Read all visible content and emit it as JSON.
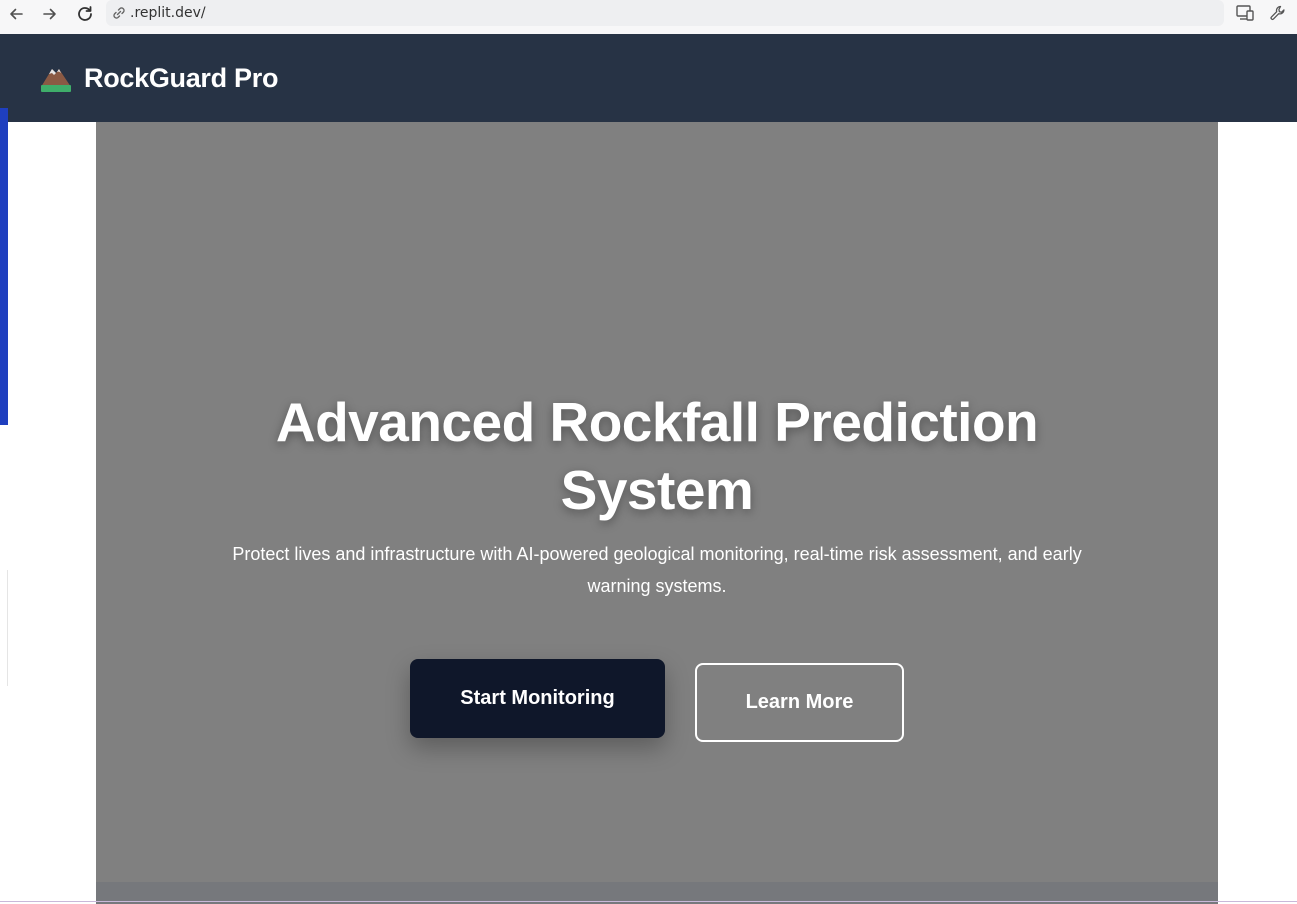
{
  "browser": {
    "url": ".replit.dev/",
    "icons": [
      "back-arrow-icon",
      "forward-arrow-icon",
      "reload-icon",
      "link-icon",
      "device-icon",
      "wrench-icon"
    ]
  },
  "header": {
    "brand_name": "RockGuard Pro",
    "logo_icon": "mountain-icon",
    "background": "#273345"
  },
  "hero": {
    "title_lines": [
      "Advanced Rockfall Prediction",
      "System"
    ],
    "subtitle_lines": [
      "Protect lives and infrastructure with AI-powered geological monitoring, real-time risk assessment, and early",
      "warning systems."
    ],
    "primary_button": "Start Monitoring",
    "secondary_button": "Learn More",
    "background": "#808080",
    "primary_button_color": "#0f172a"
  }
}
